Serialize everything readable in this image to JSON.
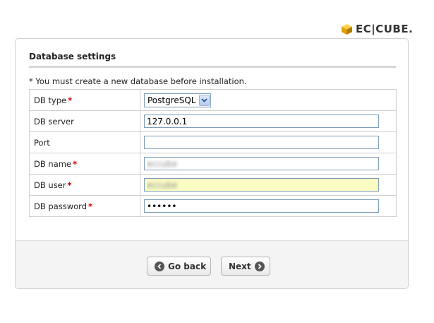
{
  "logo": {
    "text": "EC|CUBE.",
    "accent_color": "#f2b300"
  },
  "form": {
    "title": "Database settings",
    "note": "* You must create a new database before installation.",
    "required_mark": "*",
    "required_color": "#cc0000",
    "fields": [
      {
        "label": "DB type",
        "required": true,
        "type": "select",
        "value": "PostgreSQL"
      },
      {
        "label": "DB server",
        "required": false,
        "type": "text",
        "value": "127.0.0.1"
      },
      {
        "label": "Port",
        "required": false,
        "type": "text",
        "value": ""
      },
      {
        "label": "DB name",
        "required": true,
        "type": "text",
        "value": "eccube"
      },
      {
        "label": "DB user",
        "required": true,
        "type": "text",
        "value": "eccube"
      },
      {
        "label": "DB password",
        "required": true,
        "type": "password",
        "value": "••••••"
      }
    ]
  },
  "buttons": {
    "back_label": "Go back",
    "next_label": "Next"
  }
}
